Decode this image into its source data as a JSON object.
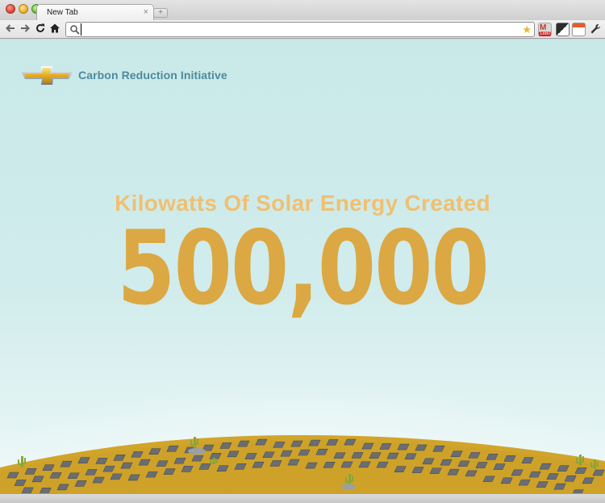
{
  "browser": {
    "tab_title": "New Tab",
    "tab_close": "×",
    "new_tab": "+",
    "address_value": "",
    "star": "★",
    "gmail_badge": "1880",
    "gmail_letter": "M",
    "wrench": "🔧"
  },
  "page": {
    "brand_title": "Carbon Reduction Initiative",
    "headline": "Kilowatts Of Solar Energy Created",
    "big_number": "500,000"
  },
  "colors": {
    "sky": "#cfeaea",
    "headline": "#efc072",
    "number": "#dba844",
    "brand": "#4e8a9c",
    "hill": "#d1a52c",
    "panel": "#6a6e72",
    "cactus": "#8aa63a"
  },
  "icons": {
    "back": "back-arrow-icon",
    "forward": "forward-arrow-icon",
    "reload": "reload-icon",
    "home": "home-icon",
    "search": "search-icon",
    "bookmark": "star-icon",
    "settings": "wrench-icon",
    "logo": "bowtie-logo-icon"
  }
}
